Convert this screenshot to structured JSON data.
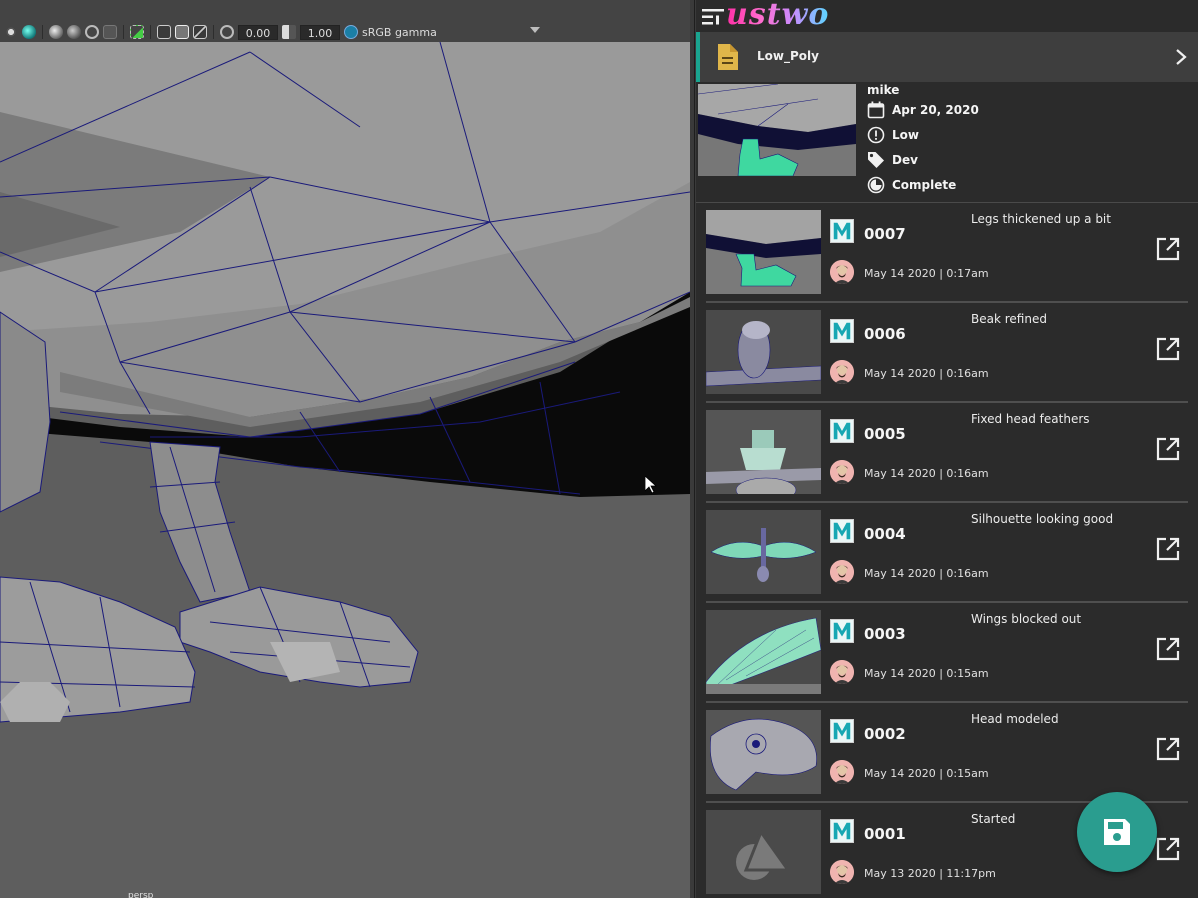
{
  "viewport": {
    "exposure_value": "0.00",
    "gamma_value": "1.00",
    "color_space": "sRGB gamma",
    "bottom_label": "persp"
  },
  "panel": {
    "logo_text": "ustwo",
    "file_name": "Low_Poly",
    "info": {
      "user": "mike",
      "date": "Apr 20, 2020",
      "priority": "Low",
      "tag": "Dev",
      "status": "Complete"
    },
    "versions": [
      {
        "version": "0007",
        "date": "May 14 2020 | 0:17am",
        "comment": "Legs thickened up a bit",
        "thumb": "legs"
      },
      {
        "version": "0006",
        "date": "May 14 2020 | 0:16am",
        "comment": "Beak refined",
        "thumb": "beak"
      },
      {
        "version": "0005",
        "date": "May 14 2020 | 0:16am",
        "comment": "Fixed head feathers",
        "thumb": "head"
      },
      {
        "version": "0004",
        "date": "May 14 2020 | 0:16am",
        "comment": "Silhouette looking good",
        "thumb": "silhouette"
      },
      {
        "version": "0003",
        "date": "May 14 2020 | 0:15am",
        "comment": "Wings blocked out",
        "thumb": "wing"
      },
      {
        "version": "0002",
        "date": "May 14 2020 | 0:15am",
        "comment": "Head modeled",
        "thumb": "headmodel"
      },
      {
        "version": "0001",
        "date": "May 13 2020 | 11:17pm",
        "comment": "Started",
        "thumb": "placeholder"
      }
    ],
    "colors": {
      "accent": "#2a9d8f",
      "file_bar_accent": "#1aa590",
      "mesh_highlight": "#3ee8a8",
      "wire": "#1a1a7a"
    }
  }
}
